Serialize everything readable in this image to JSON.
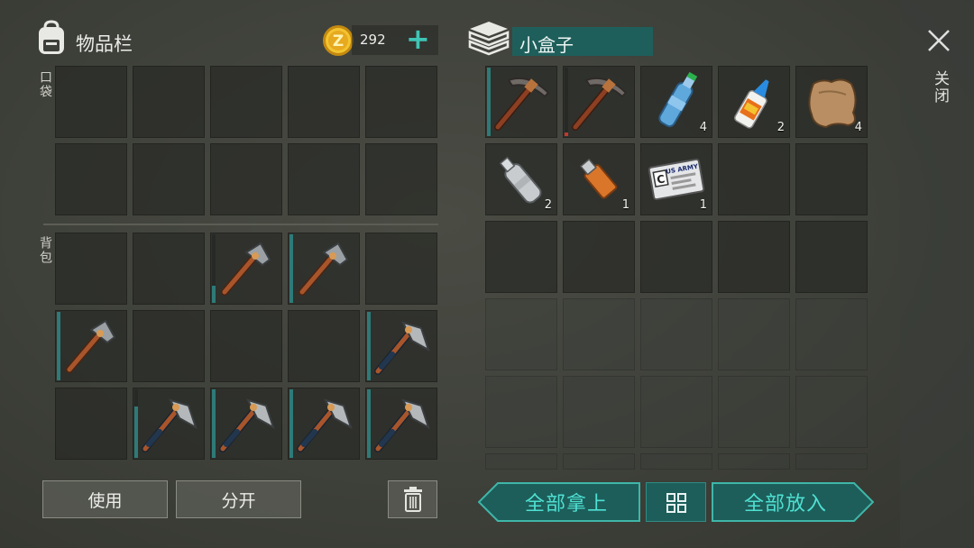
{
  "inventory": {
    "title": "物品栏",
    "pocket_label": "口袋",
    "backpack_label": "背包",
    "use_label": "使用",
    "split_label": "分开"
  },
  "currency": {
    "amount": "292",
    "plus": "+"
  },
  "container": {
    "title": "小盒子"
  },
  "close": {
    "label": "关闭"
  },
  "actions": {
    "take_all": "全部拿上",
    "put_all": "全部放入"
  },
  "colors": {
    "teal_accent": "#4fe0d2",
    "teal_bg": "#1d5e5a",
    "durability": "#2e7a78",
    "durability_low": "#c0392b"
  },
  "backpack_items": [
    {
      "row": 0,
      "col": 2,
      "item": "pickaxe",
      "durability": 0.25
    },
    {
      "row": 0,
      "col": 3,
      "item": "pickaxe",
      "durability": 1.0
    },
    {
      "row": 1,
      "col": 0,
      "item": "pickaxe",
      "durability": 1.0
    },
    {
      "row": 1,
      "col": 4,
      "item": "hatchet",
      "durability": 1.0
    },
    {
      "row": 2,
      "col": 1,
      "item": "hatchet",
      "durability": 0.75
    },
    {
      "row": 2,
      "col": 2,
      "item": "hatchet",
      "durability": 1.0
    },
    {
      "row": 2,
      "col": 3,
      "item": "hatchet",
      "durability": 1.0
    },
    {
      "row": 2,
      "col": 4,
      "item": "hatchet",
      "durability": 1.0
    }
  ],
  "container_items": [
    {
      "row": 0,
      "col": 0,
      "item": "pickaxe-wood",
      "durability": 1.0,
      "count": ""
    },
    {
      "row": 0,
      "col": 1,
      "item": "pickaxe-wood",
      "durability": 0.05,
      "count": ""
    },
    {
      "row": 0,
      "col": 2,
      "item": "water-bottle",
      "count": "4"
    },
    {
      "row": 0,
      "col": 3,
      "item": "glue",
      "count": "2"
    },
    {
      "row": 0,
      "col": 4,
      "item": "leather",
      "count": "4"
    },
    {
      "row": 1,
      "col": 0,
      "item": "empty-bottle",
      "count": "2"
    },
    {
      "row": 1,
      "col": 1,
      "item": "usb-drive",
      "count": "1"
    },
    {
      "row": 1,
      "col": 2,
      "item": "id-card",
      "count": "1",
      "card_text": "US ARMY",
      "card_letter": "C"
    }
  ]
}
